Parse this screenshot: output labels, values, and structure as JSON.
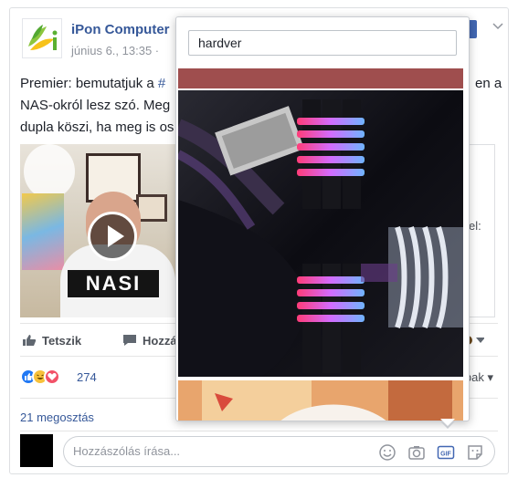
{
  "post": {
    "page_name": "iPon Computer",
    "date": "június 6., 13:35 ·",
    "text_lines": [
      "Premier: bemutatjuk a ",
      "NAS-okról lesz szó. Meg",
      "dupla köszi, ha meg is os"
    ],
    "hashtag_fragment": "#",
    "right_fragment_line1": "en a",
    "side_fragment": "el:"
  },
  "video": {
    "shirt_text": "NASI"
  },
  "actions": {
    "like_label": "Tetszik",
    "comment_label": "Hozzá"
  },
  "reactions": {
    "count": "274",
    "sort_fragment": "ibak ▾"
  },
  "shares": {
    "label": "21 megosztás"
  },
  "comment": {
    "placeholder": "Hozzászólás írása..."
  },
  "gif_picker": {
    "search_value": "hardver"
  },
  "icons": {
    "emoji": "emoji-icon",
    "camera": "camera-icon",
    "gif": "gif-icon",
    "sticker": "sticker-icon",
    "play": "play-icon"
  },
  "colors": {
    "link": "#365899",
    "accent": "#4267b2",
    "gif_strip": "#9f4e4e"
  }
}
